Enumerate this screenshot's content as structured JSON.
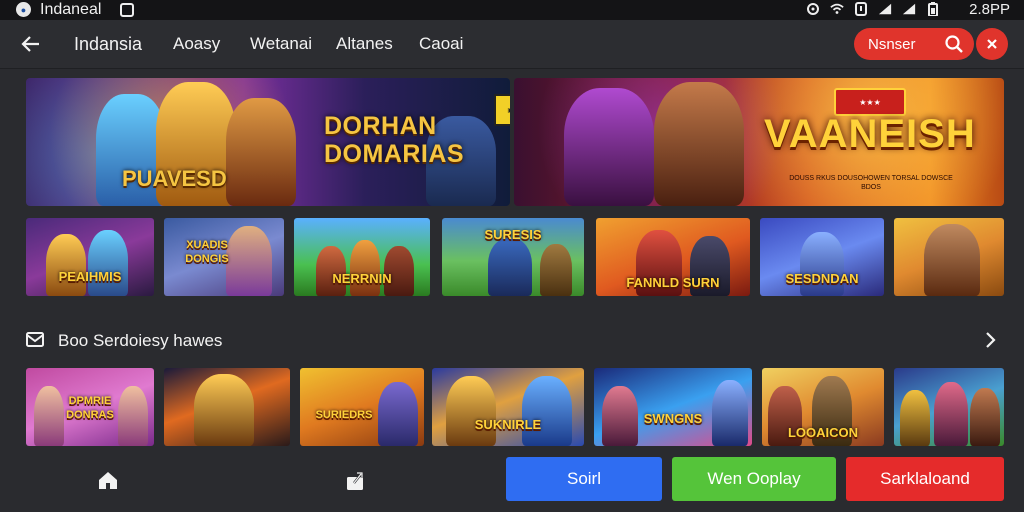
{
  "status_bar": {
    "app_title": "Indaneal",
    "time": "2.8PP",
    "icons": [
      "sync-icon",
      "wifi-icon",
      "battery-alert-icon",
      "signal-icon",
      "signal-icon",
      "battery-icon"
    ]
  },
  "top_nav": {
    "brand": "Indansia",
    "links": [
      "Aoasy",
      "Wetanai",
      "Altanes",
      "Caoai"
    ],
    "search_label": "Nsnser",
    "accent_color": "#e0342c"
  },
  "hero": {
    "left": {
      "title_line1": "DORHAN",
      "title_line2": "DOMARIAS",
      "subtitle": "PUAVESD"
    },
    "right": {
      "title": "VAANEISH",
      "tagline": "DOUSS RKUS DOUSOHOWEN TORSAL DOWSCE BDOS"
    }
  },
  "featured_row": {
    "tiles": [
      {
        "label": "PEAIHMIS"
      },
      {
        "label": "XUADIS DONGIS"
      },
      {
        "label": "NERRNIN"
      },
      {
        "label": "SURESIS"
      },
      {
        "label": "FANNLD SURN"
      },
      {
        "label": "SESDNDAN"
      },
      {
        "label": ""
      }
    ]
  },
  "section": {
    "title": "Boo Serdoiesy hawes"
  },
  "section_row": {
    "tiles": [
      {
        "label": "DPMRIE DONRAS"
      },
      {
        "label": ""
      },
      {
        "label": "SURIEDRS"
      },
      {
        "label": "SUKNIRLE"
      },
      {
        "label": "SWNGNS"
      },
      {
        "label": "LOOAICON"
      },
      {
        "label": ""
      }
    ]
  },
  "bottom_bar": {
    "buttons": [
      {
        "label": "Soirl",
        "color": "#2f6df2"
      },
      {
        "label": "Wen Ooplay",
        "color": "#55c43a"
      },
      {
        "label": "Sarklaloand",
        "color": "#e52b2b"
      }
    ]
  }
}
